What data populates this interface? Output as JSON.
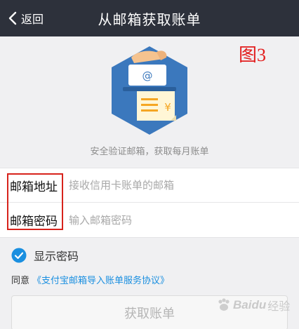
{
  "nav": {
    "back_label": "返回",
    "title": "从邮箱获取账单"
  },
  "figure_tag": "图3",
  "hero": {
    "icon": "email-bill-illustration-icon",
    "colors": {
      "hexagon": "#3b78bd",
      "hand": "#f5c38f",
      "envelope": "#ffffff",
      "bill": "#fff6d6",
      "bill_line": "#f5a623"
    }
  },
  "subtitle": "安全验证邮箱，获取每月账单",
  "form": {
    "email": {
      "label": "邮箱地址",
      "placeholder": "接收信用卡账单的邮箱",
      "value": ""
    },
    "password": {
      "label": "邮箱密码",
      "placeholder": "输入邮箱密码",
      "value": ""
    }
  },
  "show_password": {
    "label": "显示密码",
    "checked": true,
    "icon": "check-circle-icon",
    "color": "#1a8fe0"
  },
  "agreement": {
    "prefix": "同意",
    "link": "《支付宝邮箱导入账单服务协议》"
  },
  "submit": {
    "label": "获取账单",
    "enabled": false
  },
  "watermark": {
    "logo": "Baidu",
    "text": "经验"
  },
  "colors": {
    "navbar": "#2d313b",
    "background": "#f0f0f2",
    "accent": "#1a8fe0",
    "annotation": "#d7231c"
  }
}
